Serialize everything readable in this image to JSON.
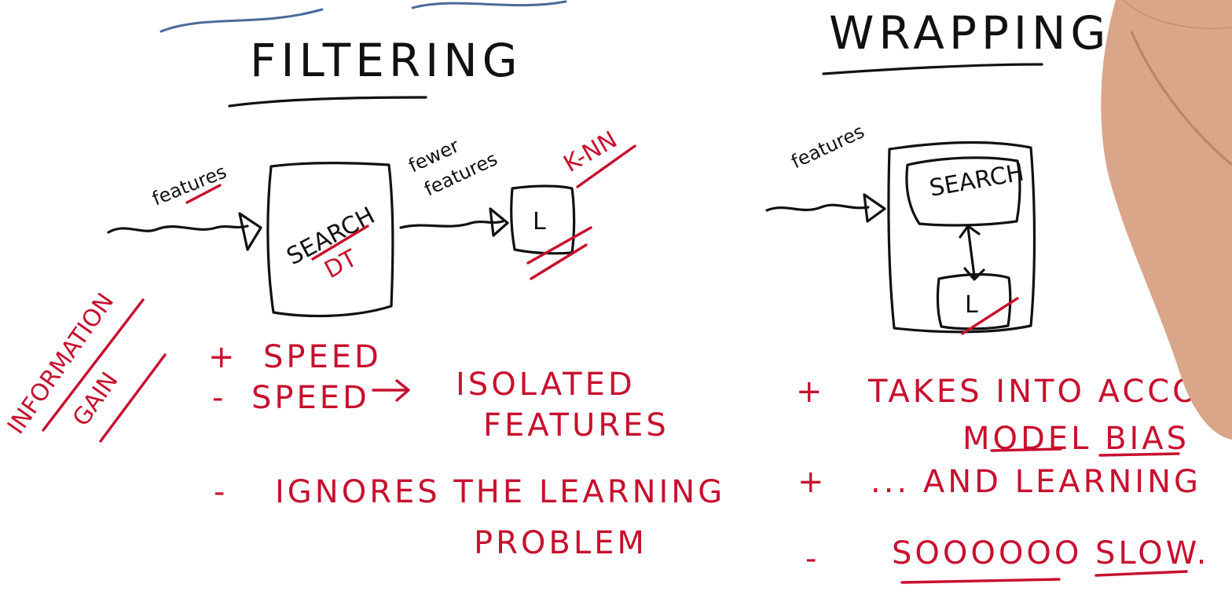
{
  "filtering": {
    "title": "FILTERING",
    "input_label": "features",
    "box_label": "SEARCH",
    "box_sublabel": "DT",
    "output_label_line1": "fewer",
    "output_label_line2": "features",
    "learner_label": "L",
    "learner_annotation": "K-NN",
    "side_note_line1": "INFORMATION",
    "side_note_line2": "GAIN",
    "points": [
      {
        "sign": "+",
        "text": "SPEED"
      },
      {
        "sign": "-",
        "text": "SPEED"
      },
      {
        "sign": "-",
        "text": "IGNORES THE LEARNING"
      }
    ],
    "speed_result_line1": "ISOLATED",
    "speed_result_line2": "FEATURES",
    "ignores_line2": "PROBLEM"
  },
  "wrapping": {
    "title": "WRAPPING",
    "input_label": "features",
    "search_label": "SEARCH",
    "learner_label": "L",
    "points": [
      {
        "sign": "+",
        "text": "TAKES INTO ACCOUNT"
      },
      {
        "sign": "+",
        "text": "... AND LEARNING"
      },
      {
        "sign": "-",
        "text": "SOOOOOO SLOW."
      }
    ],
    "takes_line2": "MODEL BIAS"
  },
  "colors": {
    "ink": "#111111",
    "annotation": "#c8102e",
    "top_scribble": "#4a6a9a",
    "hand": "#d9a68a"
  }
}
